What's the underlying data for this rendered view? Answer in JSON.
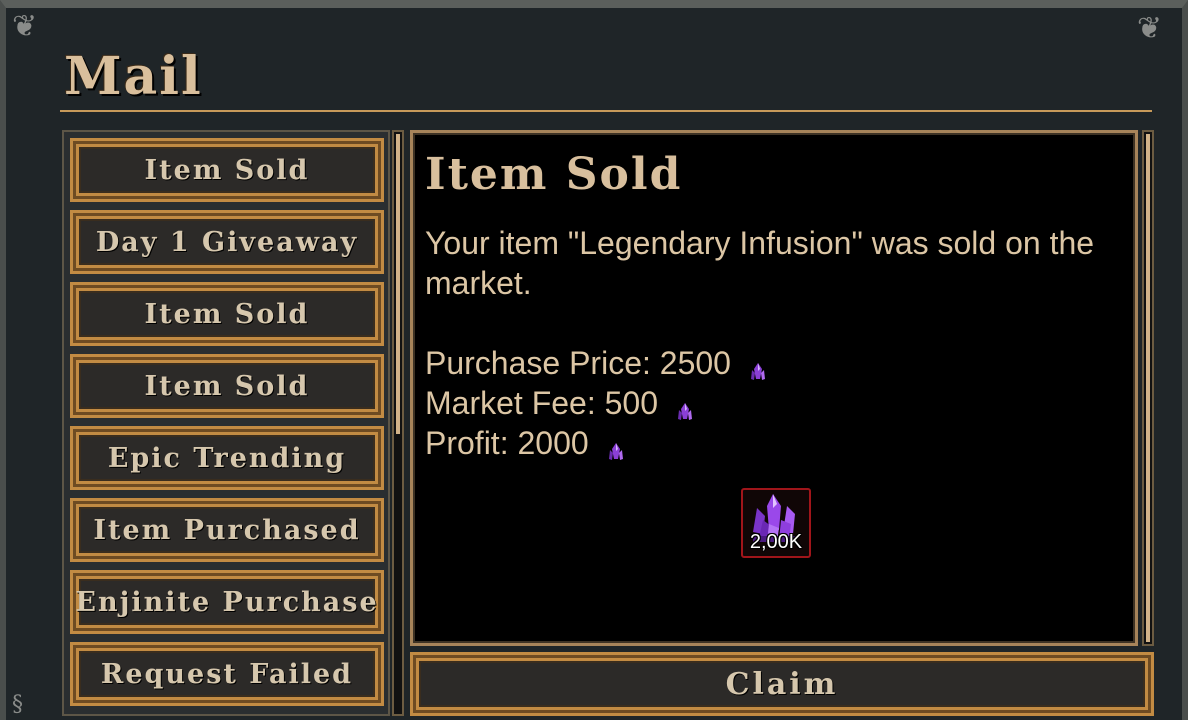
{
  "window": {
    "title": "Mail"
  },
  "sidebar": {
    "items": [
      {
        "label": "Item Sold"
      },
      {
        "label": "Day 1 Giveaway"
      },
      {
        "label": "Item Sold"
      },
      {
        "label": "Item Sold"
      },
      {
        "label": "Epic Trending"
      },
      {
        "label": "Item Purchased"
      },
      {
        "label": "Enjinite Purchase"
      },
      {
        "label": "Request Failed"
      }
    ]
  },
  "message": {
    "heading": "Item Sold",
    "body": "Your item \"Legendary Infusion\" was sold on the market.",
    "purchase_price_label": "Purchase Price: 2500",
    "market_fee_label": "Market Fee: 500",
    "profit_label": "Profit: 2000",
    "currency_icon": "purple-crystal-icon"
  },
  "reward": {
    "amount": "2,00K",
    "icon": "purple-crystal-cluster-icon"
  },
  "claim_label": "Claim",
  "colors": {
    "accent_gold": "#c28b43",
    "text_parchment": "#dcc6a5",
    "reward_border": "#a0151a",
    "crystal_purple": "#8a3fd6"
  }
}
